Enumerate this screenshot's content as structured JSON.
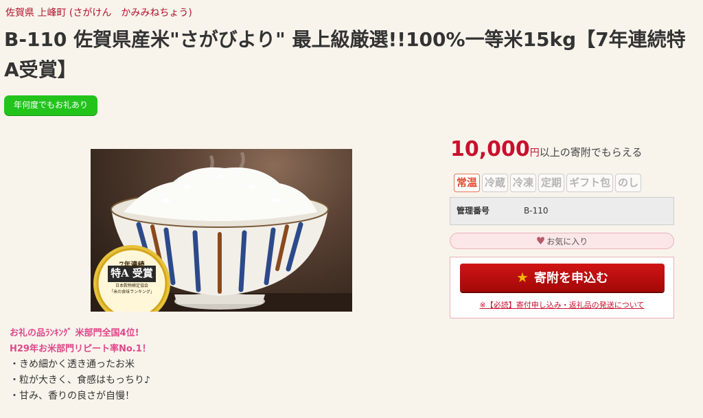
{
  "breadcrumb": "佐賀県 上峰町 (さがけん　かみみねちょう)",
  "title": "B-110 佐賀県産米\"さがびより\" 最上級厳選!!100%一等米15kg【7年連続特A受賞】",
  "green_badge": "年何度でもお礼あり",
  "image": {
    "award_line1": "7年連続",
    "award_line2": "特A 受賞",
    "award_line3": "日本穀物検定協会",
    "award_line4": "「米の食味ランキング」"
  },
  "price": {
    "amount": "10,000",
    "unit": "円",
    "suffix": "以上の寄附でもらえる"
  },
  "tags": [
    {
      "label": "常温",
      "active": true
    },
    {
      "label": "冷蔵",
      "active": false
    },
    {
      "label": "冷凍",
      "active": false
    },
    {
      "label": "定期",
      "active": false
    },
    {
      "label": "ギフト包",
      "active": false
    },
    {
      "label": "のし",
      "active": false
    }
  ],
  "management": {
    "label": "管理番号",
    "value": "B-110"
  },
  "favorite_label": "お気に入り",
  "apply": {
    "button_label": "寄附を申込む",
    "note": "※【必読】寄付申し込み・返礼品の発送について"
  },
  "highlights": [
    "お礼の品ﾗﾝｷﾝｸﾞ 米部門全国4位!",
    "H29年お米部門リピート率No.1！"
  ],
  "bullets": [
    "・きめ細かく透き通ったお米",
    "・粒が大きく、食感はもっちり♪",
    "・甘み、香りの良さが自慢！"
  ],
  "colors": {
    "accent_red": "#c8102e",
    "badge_green": "#22c41c",
    "highlight_pink": "#e0468a",
    "background": "#f8f4ec"
  }
}
